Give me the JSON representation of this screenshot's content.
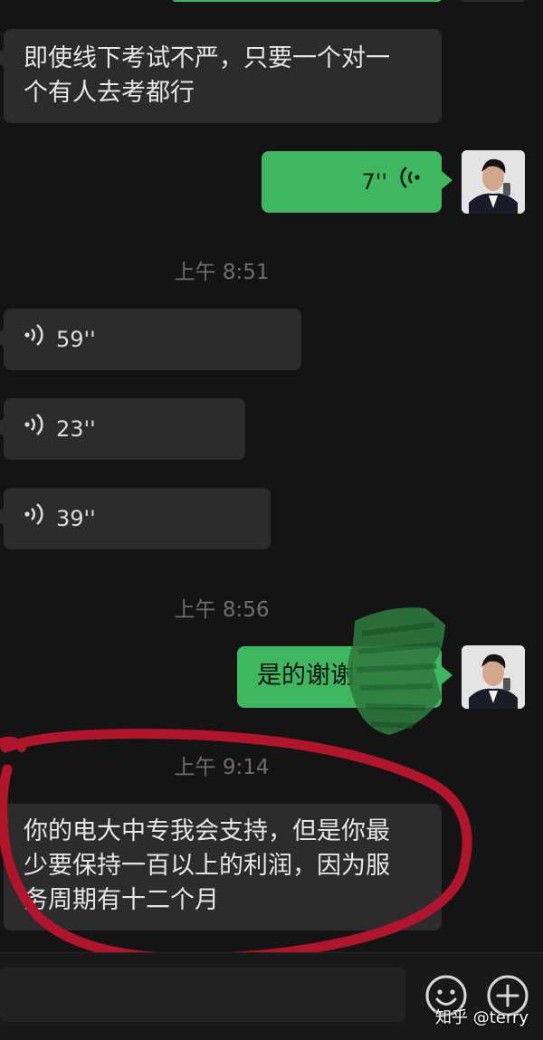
{
  "messages": {
    "m1_line1": "即使线下考试不严，只要一个对一",
    "m1_line2": "个有人去考都行",
    "voice_out": "7''",
    "time1": "上午 8:51",
    "voice_in": [
      "59''",
      "23''",
      "39''"
    ],
    "time2": "上午 8:56",
    "reply": "是的谢谢",
    "time3": "上午 9:14",
    "m2_line1": "你的电大中专我会支持，但是你最",
    "m2_line2": "少要保持一百以上的利润，因为服",
    "m2_line3": "务周期有十二个月"
  },
  "icons": {
    "voice_in": "voice-wave-icon",
    "voice_out": "voice-wave-icon",
    "emoji": "emoji-icon",
    "plus": "plus-icon",
    "avatar": "avatar"
  },
  "watermark": "知乎 @terry",
  "colors": {
    "background": "#141414",
    "incoming_bubble": "#2c2c2c",
    "outgoing_bubble": "#3eb760",
    "timestamp": "#6e6e6e",
    "annotation": "#b0152b"
  }
}
